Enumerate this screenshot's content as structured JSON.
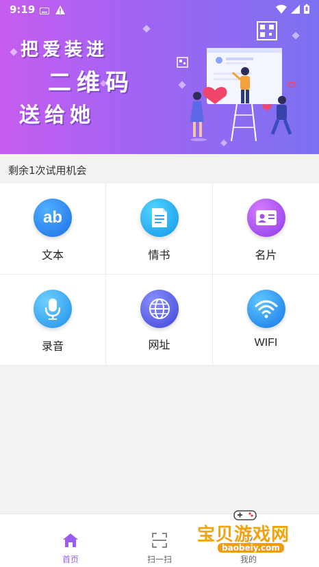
{
  "status": {
    "time": "9:19"
  },
  "hero": {
    "line1": "把爱装进",
    "line2": "二维码",
    "line3": "送给她"
  },
  "trial": {
    "text": "剩余1次试用机会"
  },
  "grid": {
    "items": [
      {
        "label": "文本",
        "icon": "ab-text-icon",
        "color": "#2f8cf0"
      },
      {
        "label": "情书",
        "icon": "document-icon",
        "color": "#1fb0f0"
      },
      {
        "label": "名片",
        "icon": "id-card-icon",
        "color": "#a24df0"
      },
      {
        "label": "录音",
        "icon": "microphone-icon",
        "color": "#2ea6f2"
      },
      {
        "label": "网址",
        "icon": "globe-icon",
        "color": "#5b66ee"
      },
      {
        "label": "WIFI",
        "icon": "wifi-icon",
        "color": "#2a9cf2"
      }
    ]
  },
  "nav": {
    "items": [
      {
        "label": "首页",
        "icon": "home-icon",
        "active": true
      },
      {
        "label": "扫一扫",
        "icon": "scan-icon",
        "active": false
      },
      {
        "label": "我的",
        "icon": "user-icon",
        "active": false
      }
    ]
  },
  "watermark": {
    "text": "宝贝游戏网",
    "url": "baobeiy.com"
  },
  "colors": {
    "accent": "#9b5cf0",
    "hero_start": "#c65df0",
    "hero_end": "#7c72f1"
  }
}
